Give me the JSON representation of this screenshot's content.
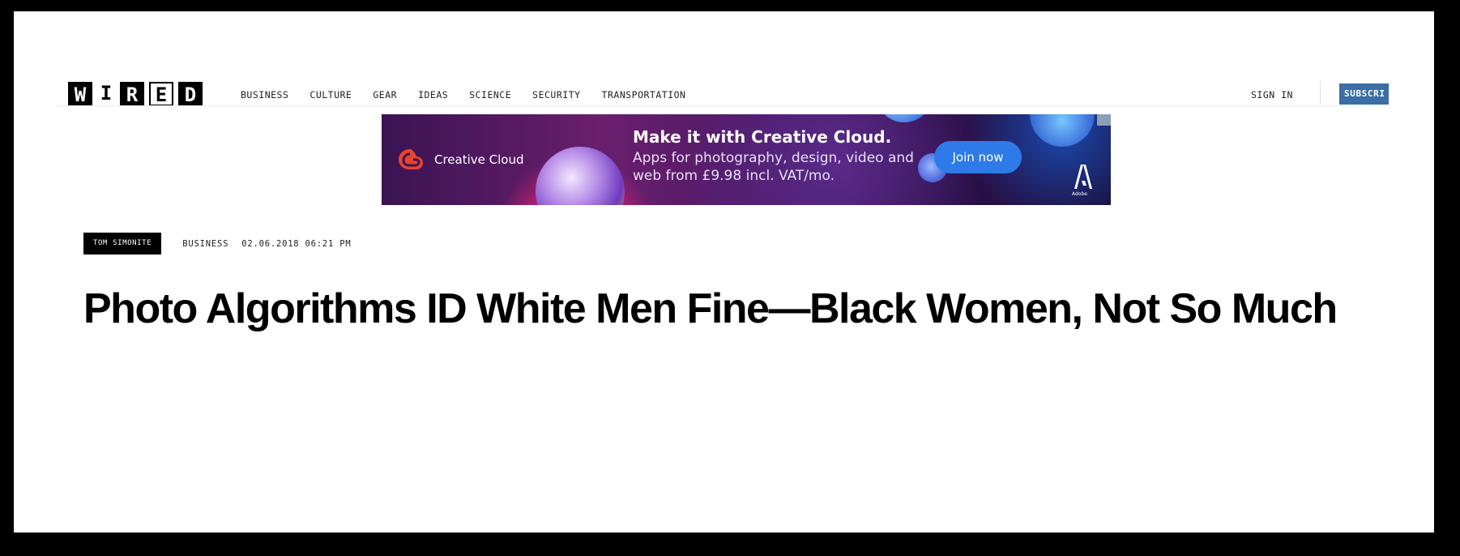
{
  "header": {
    "logo_letters": [
      "W",
      "I",
      "R",
      "E",
      "D"
    ],
    "nav": [
      "BUSINESS",
      "CULTURE",
      "GEAR",
      "IDEAS",
      "SCIENCE",
      "SECURITY",
      "TRANSPORTATION"
    ],
    "sign_in": "SIGN IN",
    "subscribe": "SUBSCRI"
  },
  "ad": {
    "brand": "Creative Cloud",
    "headline": "Make it with Creative Cloud.",
    "body": "Apps for photography, design, video and web from £9.98 incl. VAT/mo.",
    "cta": "Join now",
    "sponsor": "Adobe"
  },
  "article": {
    "author": "TOM SIMONITE",
    "category": "BUSINESS",
    "date": "02.06.2018 06:21 PM",
    "title": "Photo Algorithms ID White Men Fine—Black Women, Not So Much"
  },
  "colors": {
    "subscribe_bg": "#3a6ea5",
    "cta_bg": "#2d7ae8",
    "frame": "#000000"
  }
}
